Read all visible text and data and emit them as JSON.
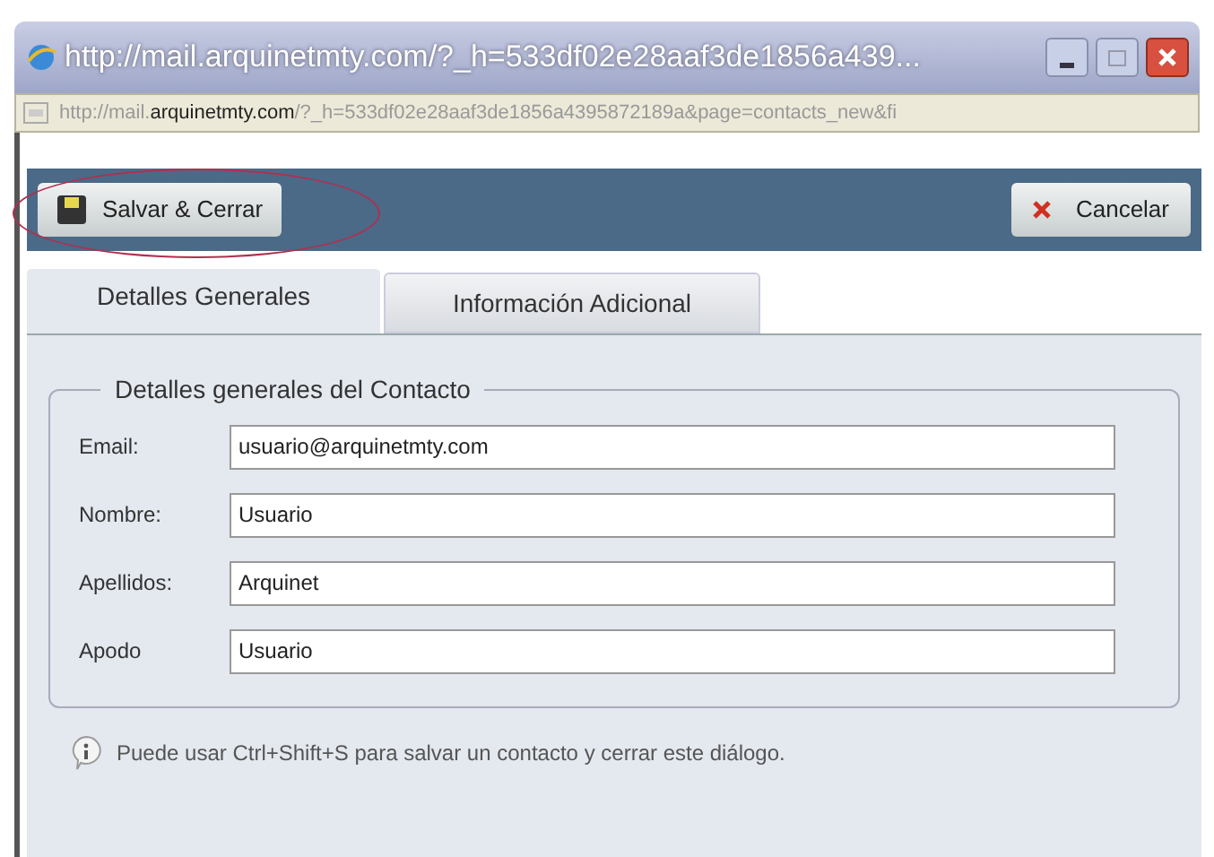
{
  "window": {
    "title": "http://mail.arquinetmty.com/?_h=533df02e28aaf3de1856a439..."
  },
  "address_bar": {
    "prefix": "http://mail.",
    "domain": "arquinetmty.com",
    "rest": "/?_h=533df02e28aaf3de1856a4395872189a&page=contacts_new&fi"
  },
  "toolbar": {
    "save": "Salvar & Cerrar",
    "save_highlighted": true,
    "cancel": "Cancelar"
  },
  "tabs": [
    {
      "label": "Detalles Generales",
      "selected": true
    },
    {
      "label": "Información Adicional",
      "selected": false
    }
  ],
  "fieldset": {
    "legend": "Detalles generales del Contacto",
    "fields": [
      {
        "label": "Email:",
        "value": "usuario@arquinetmty.com"
      },
      {
        "label": "Nombre:",
        "value": "Usuario"
      },
      {
        "label": "Apellidos:",
        "value": "Arquinet"
      },
      {
        "label": "Apodo",
        "value": "Usuario"
      }
    ]
  },
  "hint": "Puede usar Ctrl+Shift+S para salvar un contacto y cerrar este diálogo."
}
